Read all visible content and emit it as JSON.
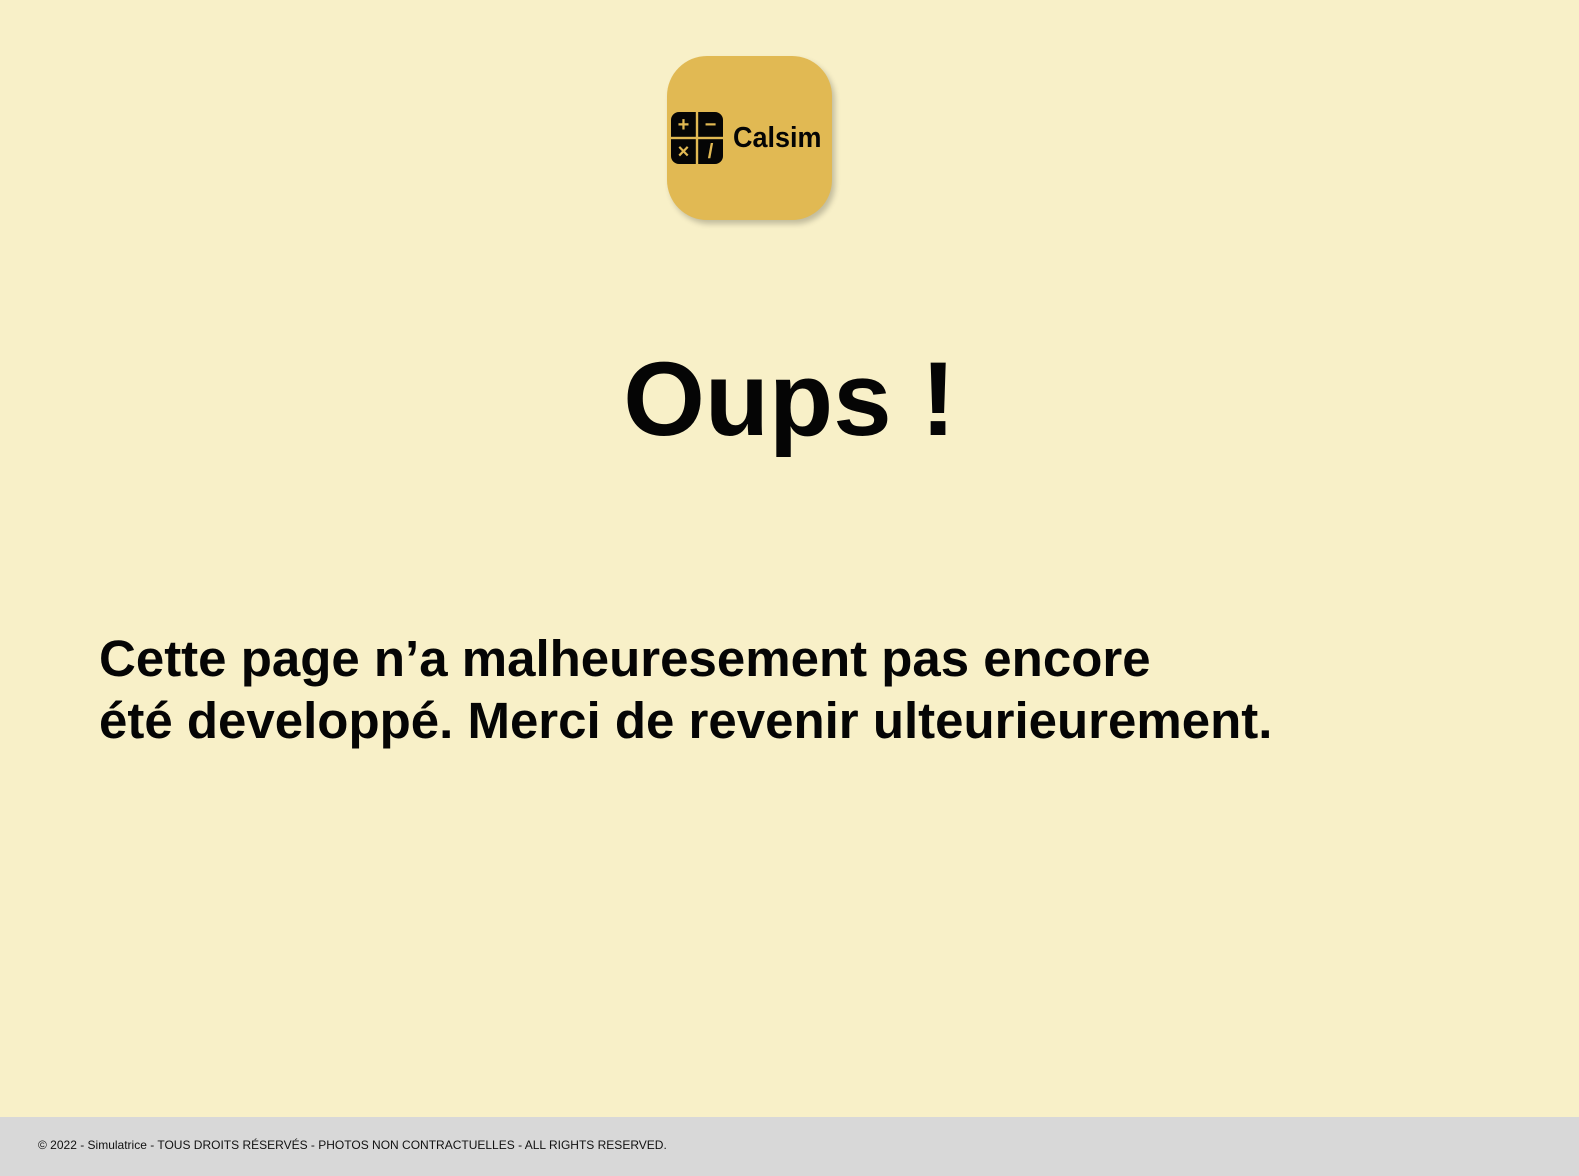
{
  "brand": {
    "name": "Calsim",
    "logo_icon": "calculator-grid-icon",
    "tile_color": "#e1b953",
    "icon_symbols": [
      "+",
      "−",
      "×",
      "/"
    ]
  },
  "error": {
    "title": "Oups !",
    "message_lines": [
      "Cette page n’a malheuresement pas encore",
      "été developpé. Merci de revenir ulteurieurement."
    ]
  },
  "footer": {
    "text": "© 2022 - Simulatrice - TOUS DROITS RÉSERVÉS - PHOTOS NON CONTRACTUELLES - ALL RIGHTS RESERVED."
  },
  "colors": {
    "page_background": "#f8f0c8",
    "footer_background": "#d8d8d8",
    "text": "#050505"
  }
}
